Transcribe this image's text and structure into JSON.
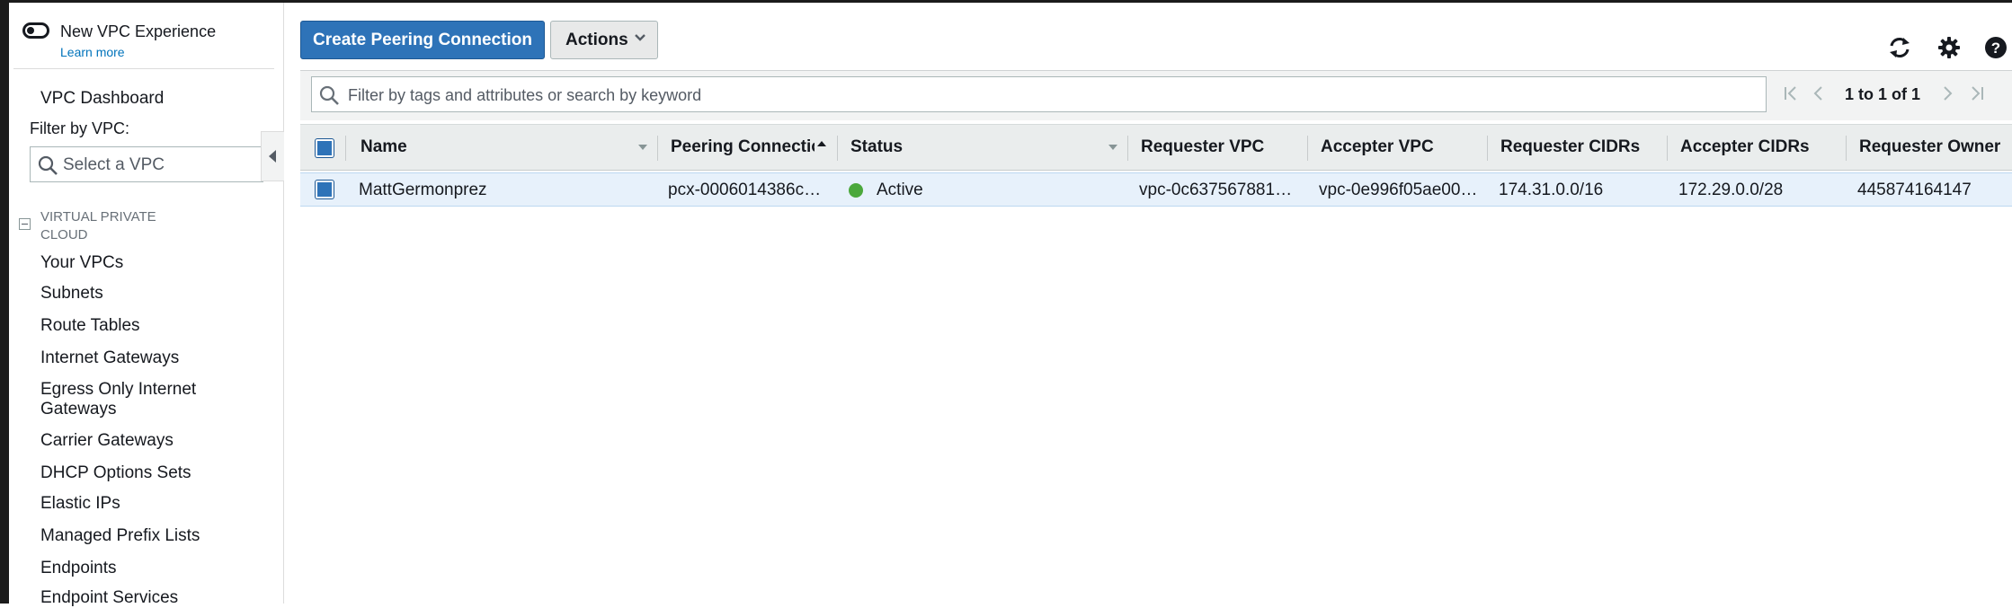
{
  "app": {
    "new_experience_label": "New VPC Experience",
    "learn_more": "Learn more"
  },
  "sidebar": {
    "dashboard": "VPC Dashboard",
    "filter_label": "Filter by VPC:",
    "select_placeholder": "Select a VPC",
    "section_title": "VIRTUAL PRIVATE CLOUD",
    "items": [
      {
        "label": "Your VPCs"
      },
      {
        "label": "Subnets"
      },
      {
        "label": "Route Tables"
      },
      {
        "label": "Internet Gateways"
      },
      {
        "label": "Egress Only Internet Gateways"
      },
      {
        "label": "Carrier Gateways"
      },
      {
        "label": "DHCP Options Sets"
      },
      {
        "label": "Elastic IPs"
      },
      {
        "label": "Managed Prefix Lists"
      },
      {
        "label": "Endpoints"
      },
      {
        "label": "Endpoint Services"
      }
    ]
  },
  "toolbar": {
    "create_label": "Create Peering Connection",
    "actions_label": "Actions",
    "refresh_icon": "refresh-icon",
    "settings_icon": "gear-icon",
    "help_icon": "help-icon"
  },
  "search": {
    "placeholder": "Filter by tags and attributes or search by keyword"
  },
  "pagination": {
    "text": "1 to 1 of 1"
  },
  "table": {
    "columns": [
      "Name",
      "Peering Connection ID",
      "Status",
      "Requester VPC",
      "Accepter VPC",
      "Requester CIDRs",
      "Accepter CIDRs",
      "Requester Owner"
    ],
    "rows": [
      {
        "name": "MattGermonprez",
        "peering_id": "pcx-0006014386c…",
        "status": "Active",
        "requester_vpc": "vpc-0c637567881…",
        "accepter_vpc": "vpc-0e996f05ae00…",
        "requester_cidrs": "174.31.0.0/16",
        "accepter_cidrs": "172.29.0.0/28",
        "requester_owner": "445874164147"
      }
    ]
  },
  "colors": {
    "primary_button": "#2e73b8",
    "status_active": "#4ba83c",
    "link": "#0073bb",
    "selected_row": "#e7f1fb"
  }
}
